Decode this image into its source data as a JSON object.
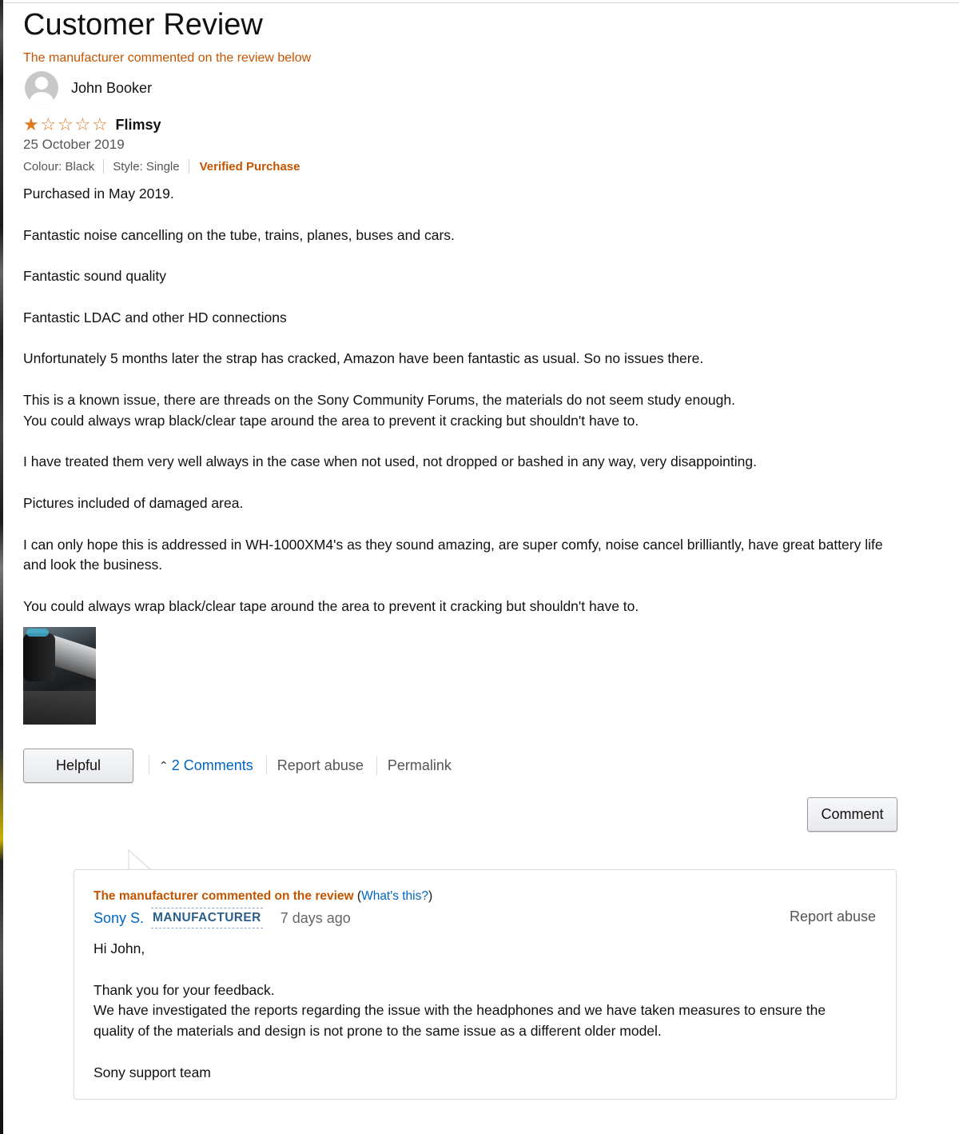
{
  "page": {
    "title": "Customer Review",
    "manufacturer_note": "The manufacturer commented on the review below"
  },
  "reviewer": {
    "name": "John Booker"
  },
  "review": {
    "rating": 1,
    "max_rating": 5,
    "title": "Flimsy",
    "date": "25 October 2019",
    "variant": {
      "colour": "Colour: Black",
      "style": "Style: Single"
    },
    "verified_label": "Verified Purchase",
    "paragraphs": [
      "Purchased in May 2019.",
      "Fantastic noise cancelling on the tube, trains, planes, buses and cars.",
      "Fantastic sound quality",
      "Fantastic LDAC and other HD connections",
      "Unfortunately 5 months later the strap has cracked, Amazon have been fantastic as usual. So no issues there.",
      "This is a known issue, there are threads on the Sony Community Forums, the materials do not seem study enough.\nYou could always wrap black/clear tape around the area to prevent it cracking but shouldn't have to.",
      "I have treated them very well always in the case when not used, not dropped or bashed in any way, very disappointing.",
      "Pictures included of damaged area.",
      "I can only hope this is addressed in WH-1000XM4's as they sound amazing, are super comfy, noise cancel brilliantly, have great battery life\nand look the business.",
      "You could always wrap black/clear tape around the area to prevent it cracking but shouldn't have to."
    ]
  },
  "actions": {
    "helpful_label": "Helpful",
    "comments_label": "2 Comments",
    "report_label": "Report abuse",
    "permalink_label": "Permalink",
    "comment_button_label": "Comment"
  },
  "manufacturer_comment": {
    "header_label": "The manufacturer commented on the review",
    "whats_this": "What's this?",
    "author": "Sony S.",
    "badge": "MANUFACTURER",
    "time": "7 days ago",
    "report_label": "Report abuse",
    "paragraphs": [
      "Hi John,",
      "Thank you for your feedback.\nWe have investigated the reports regarding the issue with the headphones and we have taken measures to ensure the\nquality of the materials and design is not prone to the same issue as a different older model.",
      "Sony support team"
    ]
  },
  "colors": {
    "accent_orange": "#c45500",
    "link_blue": "#0066c0",
    "star": "#de7921"
  },
  "icons": {
    "avatar": "user-silhouette-icon",
    "star": "star-icon",
    "caret": "caret-up-icon"
  }
}
